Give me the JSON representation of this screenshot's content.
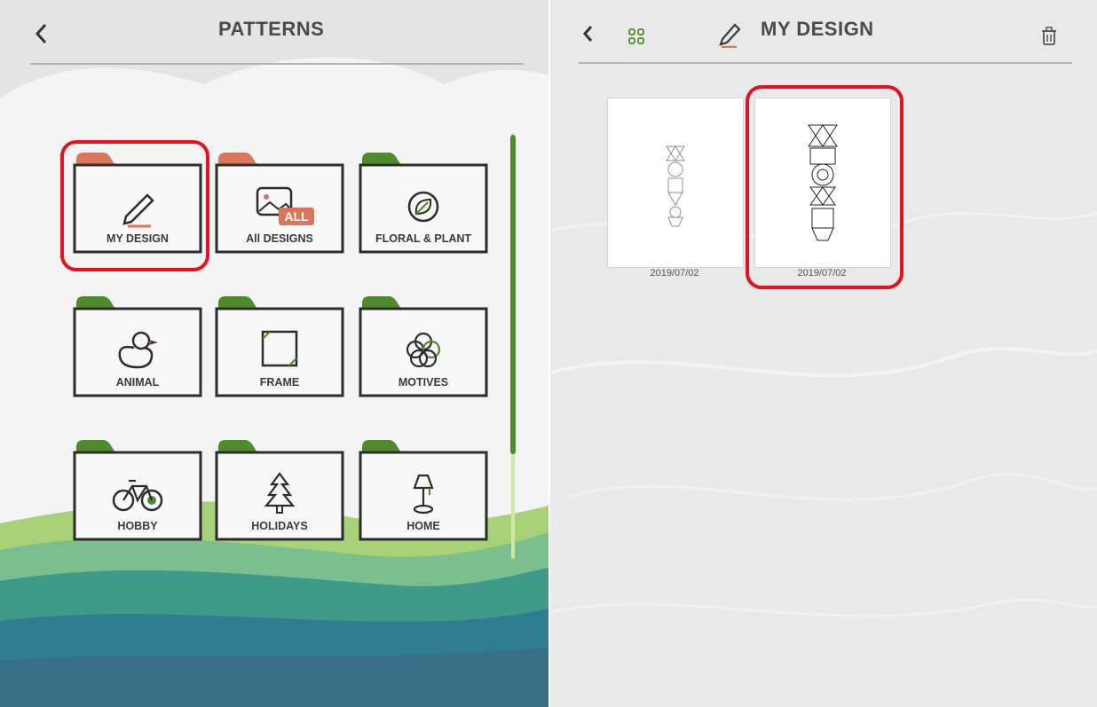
{
  "patterns_screen": {
    "title": "PATTERNS",
    "categories": [
      {
        "label": "MY DESIGN",
        "icon": "pencil-icon",
        "tab_color": "#d9765c"
      },
      {
        "label": "All DESIGNS",
        "icon": "image-all-icon",
        "tab_color": "#d9765c"
      },
      {
        "label": "FLORAL & PLANT",
        "icon": "leaf-icon",
        "tab_color": "#4f8a2e"
      },
      {
        "label": "ANIMAL",
        "icon": "duck-icon",
        "tab_color": "#4f8a2e"
      },
      {
        "label": "FRAME",
        "icon": "frame-icon",
        "tab_color": "#4f8a2e"
      },
      {
        "label": "MOTIVES",
        "icon": "motif-icon",
        "tab_color": "#4f8a2e"
      },
      {
        "label": "HOBBY",
        "icon": "bicycle-icon",
        "tab_color": "#4f8a2e"
      },
      {
        "label": "HOLIDAYS",
        "icon": "tree-icon",
        "tab_color": "#4f8a2e"
      },
      {
        "label": "HOME",
        "icon": "lamp-icon",
        "tab_color": "#4f8a2e"
      }
    ],
    "all_badge": "ALL"
  },
  "my_design_screen": {
    "title": "MY DESIGN",
    "designs": [
      {
        "date": "2019/07/02"
      },
      {
        "date": "2019/07/02"
      }
    ]
  },
  "colors": {
    "highlight": "#e0141e",
    "accent_green": "#4f8a2e",
    "accent_orange": "#d9765c"
  }
}
